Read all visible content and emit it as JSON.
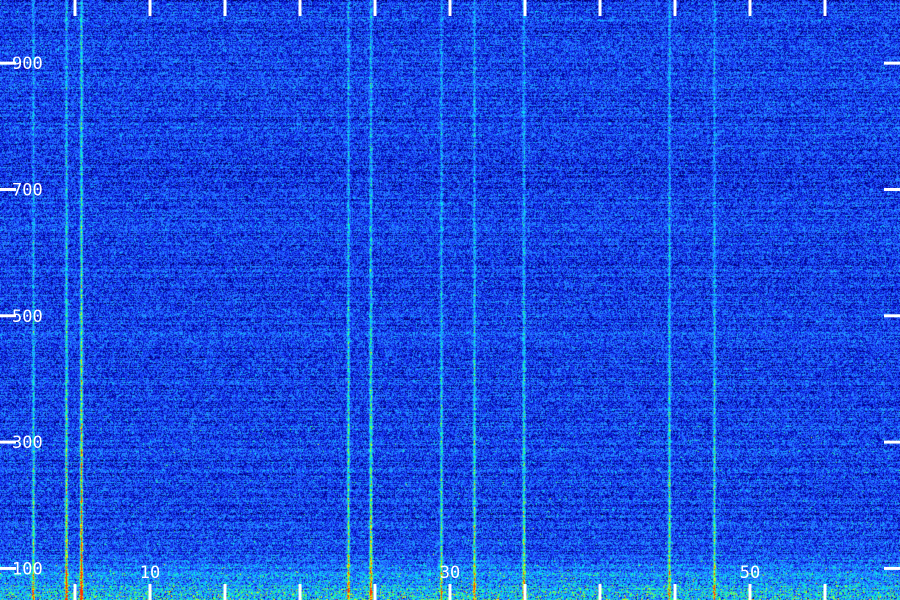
{
  "chart_data": {
    "type": "heatmap",
    "title": "",
    "xlabel": "",
    "ylabel": "",
    "xlim": [
      0,
      60
    ],
    "ylim": [
      50,
      1000
    ],
    "x_tick_labels": [
      "10",
      "30",
      "50"
    ],
    "x_tick_values": [
      10,
      30,
      50
    ],
    "x_minor_ticks": [
      5,
      10,
      15,
      20,
      25,
      30,
      35,
      40,
      45,
      50,
      55
    ],
    "y_tick_labels": [
      "100",
      "300",
      "500",
      "700",
      "900"
    ],
    "y_tick_values": [
      100,
      300,
      500,
      700,
      900
    ],
    "colormap": [
      "#000000",
      "#0000a0",
      "#1a3cff",
      "#2a8cff",
      "#00e6ff",
      "#40ff60",
      "#ffff00",
      "#ff3000"
    ],
    "background_level": 0.28,
    "vertical_lines": [
      {
        "x": 2.2,
        "intensity": 0.55
      },
      {
        "x": 4.4,
        "intensity": 0.75
      },
      {
        "x": 5.4,
        "intensity": 1.0
      },
      {
        "x": 23.2,
        "intensity": 0.65
      },
      {
        "x": 24.7,
        "intensity": 0.8
      },
      {
        "x": 29.4,
        "intensity": 0.55
      },
      {
        "x": 31.6,
        "intensity": 0.6
      },
      {
        "x": 34.9,
        "intensity": 0.65
      },
      {
        "x": 44.6,
        "intensity": 0.6
      },
      {
        "x": 47.6,
        "intensity": 0.55
      }
    ],
    "low_band": {
      "y_max": 130,
      "intensity": 0.55
    }
  },
  "colors": {
    "axis": "#ffffff",
    "background": "#000000"
  }
}
